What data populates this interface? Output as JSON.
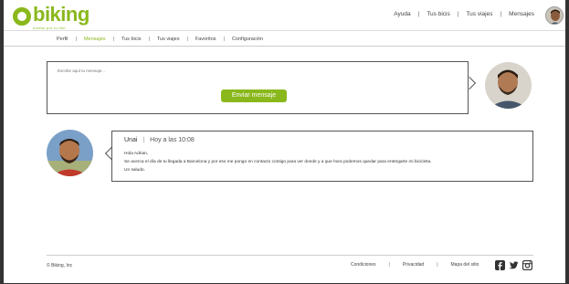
{
  "brand": {
    "name": "biking",
    "tagline": "unidos por tu bici",
    "accent_color": "#8ab81c"
  },
  "top_nav": {
    "items": [
      {
        "label": "Ayuda"
      },
      {
        "label": "Tus bicis"
      },
      {
        "label": "Tus viajes"
      },
      {
        "label": "Mensajes"
      }
    ]
  },
  "sub_nav": {
    "items": [
      {
        "label": "Perfil"
      },
      {
        "label": "Mensajes",
        "active": true
      },
      {
        "label": "Tus bicis"
      },
      {
        "label": "Tus viajes"
      },
      {
        "label": "Favoritos"
      },
      {
        "label": "Configuración"
      }
    ]
  },
  "compose": {
    "placeholder": "Escribe aquí tu mensaje...",
    "send_label": "Enviar mensaje"
  },
  "message": {
    "author": "Unai",
    "separator": "|",
    "time": "Hoy a las 10:08",
    "lines": [
      "Hola Adrian,",
      "Se acerca el día de tu llegada a Barcelona y por eso me pongo en contacto contigo para ver donde y a que hora podemos quedar para entregarte mi bicicleta.",
      "Un saludo."
    ]
  },
  "footer": {
    "copyright": "© Biking, Inc",
    "links": [
      {
        "label": "Condiciones"
      },
      {
        "label": "Privacidad"
      },
      {
        "label": "Mapa del sitio"
      }
    ],
    "social_icons": [
      "facebook-icon",
      "twitter-icon",
      "instagram-icon"
    ]
  }
}
